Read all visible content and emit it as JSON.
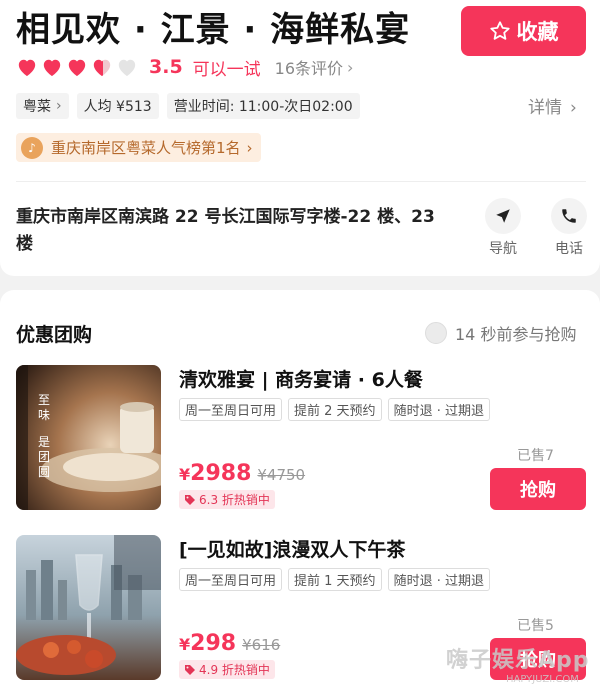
{
  "restaurant": {
    "name": "相见欢 · 江景 · 海鲜私宴",
    "favorite_label": "收藏",
    "rating": "3.5",
    "rating_text": "可以一试",
    "review_count": "16条评价",
    "hearts": {
      "full": 3,
      "half": 1,
      "empty": 1
    },
    "tags": [
      "粤菜",
      "人均 ¥513",
      "营业时间: 11:00-次日02:00"
    ],
    "details_label": "详情",
    "rank_text": "重庆南岸区粤菜人气榜第1名",
    "address": "重庆市南岸区南滨路 22 号长江国际写字楼-22 楼、23 楼",
    "actions": {
      "navigate": "导航",
      "phone": "电话"
    }
  },
  "deals_section": {
    "title": "优惠团购",
    "recent_activity": "14 秒前参与抢购",
    "deals": [
      {
        "title": "清欢雅宴 | 商务宴请 · 6人餐",
        "tags": [
          "周一至周日可用",
          "提前 2 天预约",
          "随时退 · 过期退"
        ],
        "currency": "¥",
        "price": "2988",
        "original_price": "¥4750",
        "promo": "6.3 折热销中",
        "sold": "已售7",
        "buy_label": "抢购",
        "image_text": [
          "至",
          "味",
          "是",
          "团",
          "圆"
        ]
      },
      {
        "title": "[一见如故]浪漫双人下午茶",
        "tags": [
          "周一至周日可用",
          "提前 1 天预约",
          "随时退 · 过期退"
        ],
        "currency": "¥",
        "price": "298",
        "original_price": "¥616",
        "promo": "4.9 折热销中",
        "sold": "已售5",
        "buy_label": "抢购"
      }
    ]
  },
  "watermark": {
    "text": "嗨子娱乐App",
    "sub": "HAPYJUZI.COM"
  },
  "colors": {
    "accent": "#f5355a",
    "rank_bg": "#fdeee0",
    "rank_text": "#b5692c"
  }
}
